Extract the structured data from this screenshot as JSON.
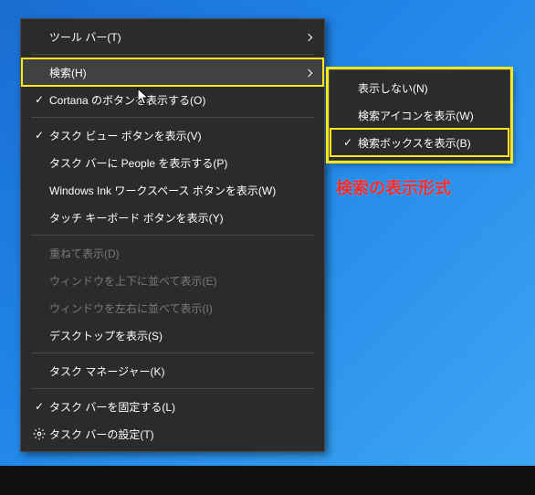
{
  "mainMenu": {
    "toolbars": "ツール バー(T)",
    "search": "検索(H)",
    "cortana": "Cortana のボタンを表示する(O)",
    "taskView": "タスク ビュー ボタンを表示(V)",
    "people": "タスク バーに People を表示する(P)",
    "ink": "Windows Ink ワークスペース ボタンを表示(W)",
    "touchKeyboard": "タッチ キーボード ボタンを表示(Y)",
    "cascade": "重ねて表示(D)",
    "stackVert": "ウィンドウを上下に並べて表示(E)",
    "stackHoriz": "ウィンドウを左右に並べて表示(I)",
    "showDesktop": "デスクトップを表示(S)",
    "taskManager": "タスク マネージャー(K)",
    "lockTaskbar": "タスク バーを固定する(L)",
    "taskbarSettings": "タスク バーの設定(T)"
  },
  "subMenu": {
    "hidden": "表示しない(N)",
    "iconOnly": "検索アイコンを表示(W)",
    "searchBox": "検索ボックスを表示(B)"
  },
  "annotation": "検索の表示形式"
}
